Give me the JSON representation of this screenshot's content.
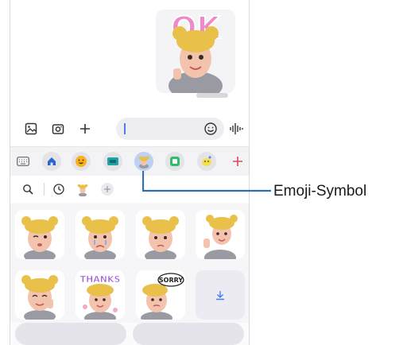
{
  "chat": {
    "sticker_text": "OK",
    "timestamp": ""
  },
  "composer": {
    "icons": [
      "gallery-icon",
      "camera-icon",
      "plus-icon"
    ],
    "input_value": "",
    "right_icons": [
      "emoji-icon",
      "voice-icon"
    ]
  },
  "tabs": {
    "items": [
      "keyboard-icon",
      "home-icon",
      "emoji-icon",
      "gif-icon",
      "ar-emoji-icon",
      "sticker-icon",
      "bitmoji-icon",
      "add-icon"
    ],
    "active": "ar-emoji-icon"
  },
  "subtabs": {
    "items": [
      "search-icon",
      "recent-icon",
      "avatar-icon",
      "add-icon"
    ]
  },
  "stickers": {
    "labels": [
      "THANKS",
      "SORRY"
    ]
  },
  "buttons": {
    "left": "",
    "right": ""
  },
  "callout": {
    "label": "Emoji-Symbol"
  },
  "colors": {
    "accent": "#4a7df0",
    "active_tab": "#bcd1f3",
    "callout_line": "#2f6fb8",
    "hair": "#e8c04a",
    "skin": "#f3c3ad",
    "hoodie": "#9a9aa2"
  }
}
